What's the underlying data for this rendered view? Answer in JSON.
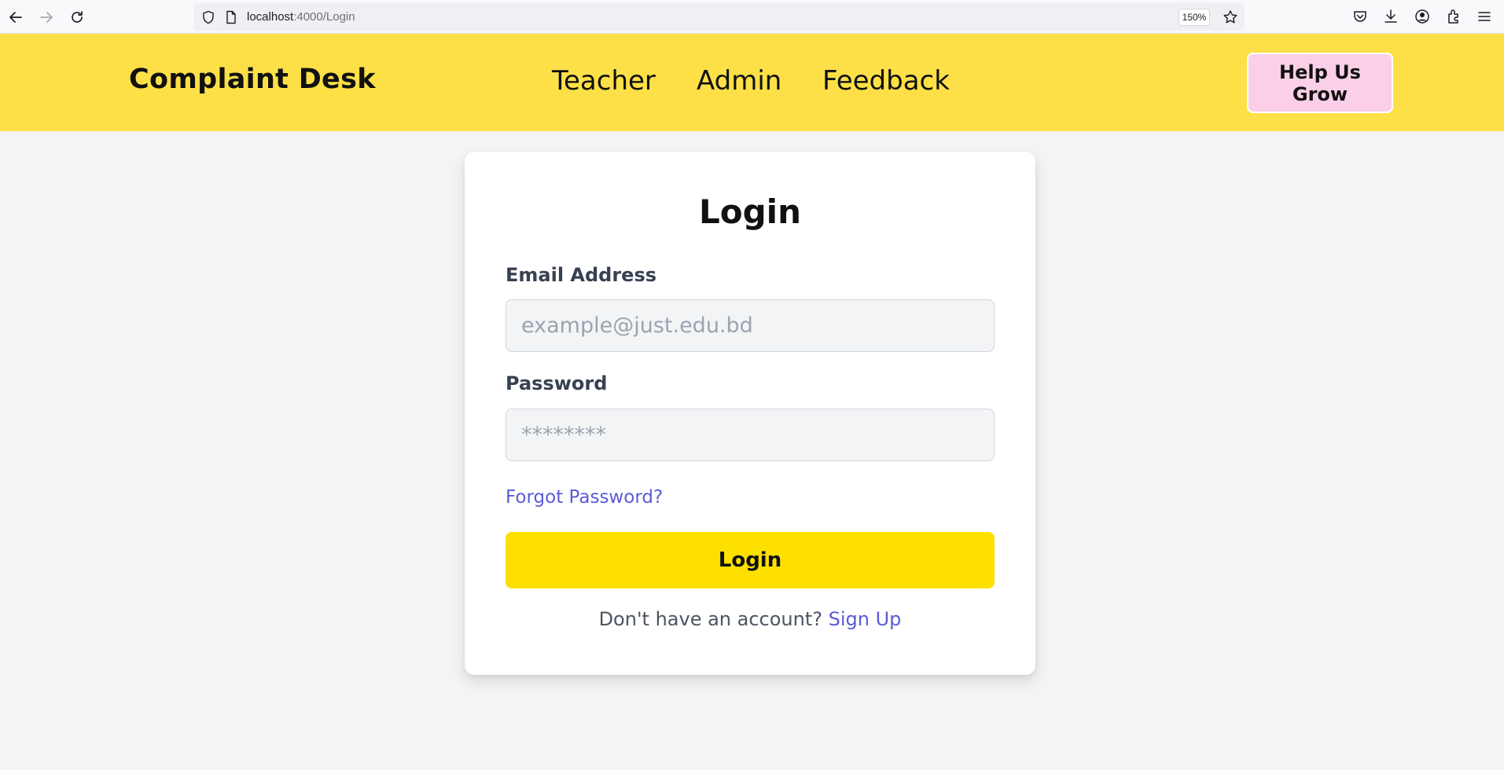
{
  "browser": {
    "url_host": "localhost",
    "url_path": ":4000/Login",
    "zoom": "150%"
  },
  "header": {
    "brand": "Complaint Desk",
    "nav": [
      {
        "label": "Teacher"
      },
      {
        "label": "Admin"
      },
      {
        "label": "Feedback"
      }
    ],
    "help_button": "Help Us Grow"
  },
  "login": {
    "title": "Login",
    "email_label": "Email Address",
    "email_placeholder": "example@just.edu.bd",
    "password_label": "Password",
    "password_placeholder": "********",
    "forgot": "Forgot Password?",
    "submit": "Login",
    "signup_prompt": "Don't have an account?",
    "signup_link": "Sign Up"
  },
  "colors": {
    "header_bg": "#fde047",
    "help_button_bg": "#fbcfe8",
    "login_button_bg": "#fde000",
    "link": "#5b5bd6",
    "page_bg": "#f3f4f6"
  }
}
